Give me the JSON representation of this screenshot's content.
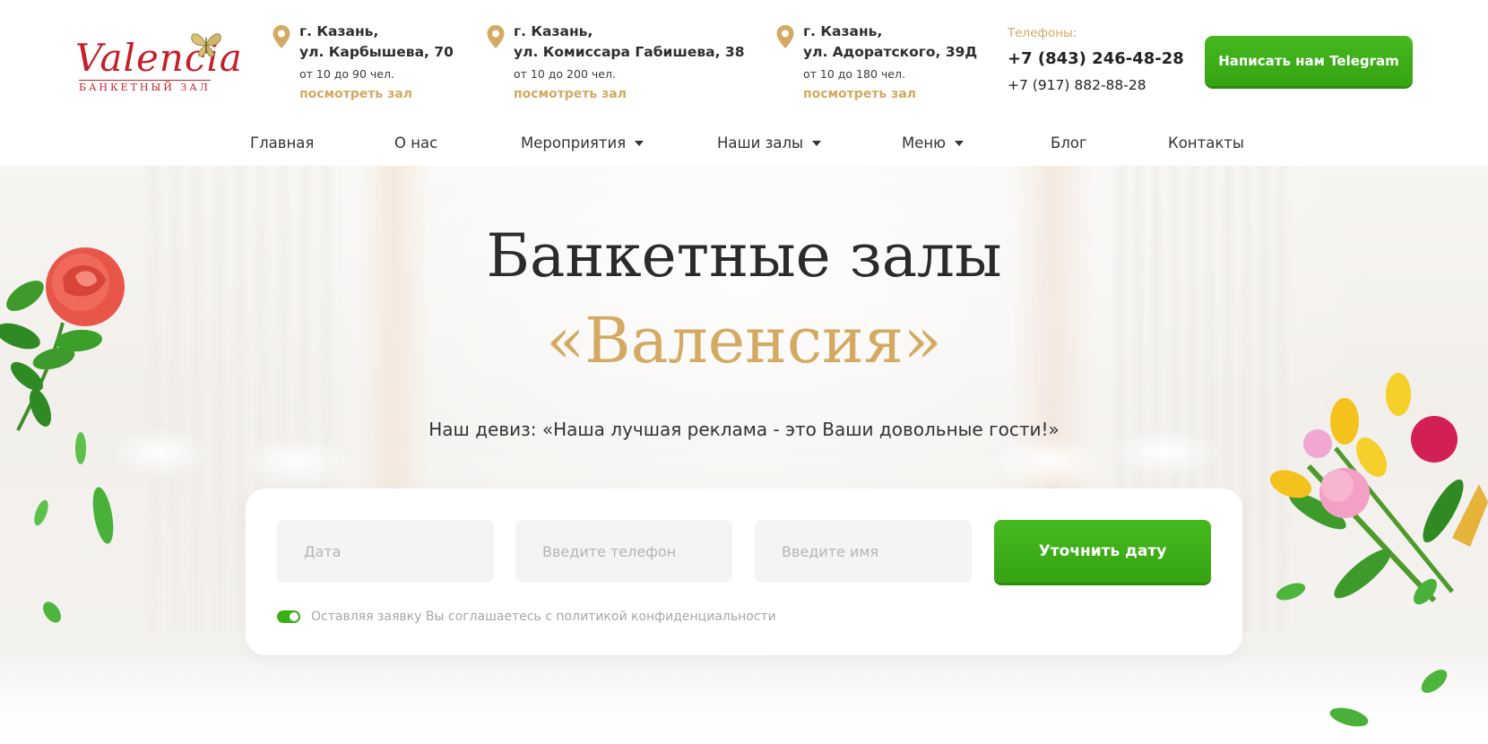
{
  "logo": {
    "name": "Valencia",
    "subtitle": "БАНКЕТНЫЙ ЗАЛ"
  },
  "addresses": [
    {
      "city": "г. Казань,",
      "street": "ул. Карбышева, 70",
      "capacity": "от 10 до 90 чел.",
      "link": "посмотреть зал"
    },
    {
      "city": "г. Казань,",
      "street": "ул. Комиссара Габишева, 38",
      "capacity": "от 10 до 200 чел.",
      "link": "посмотреть зал"
    },
    {
      "city": "г. Казань,",
      "street": "ул. Адоратского, 39Д",
      "capacity": "от 10 до 180 чел.",
      "link": "посмотреть зал"
    }
  ],
  "phones": {
    "label": "Телефоны:",
    "primary": "+7 (843) 246-48-28",
    "secondary": "+7 (917) 882-88-28"
  },
  "telegram_button": "Написать нам Telegram",
  "nav": [
    {
      "label": "Главная",
      "has_dropdown": false
    },
    {
      "label": "О нас",
      "has_dropdown": false
    },
    {
      "label": "Мероприятия",
      "has_dropdown": true
    },
    {
      "label": "Наши залы",
      "has_dropdown": true
    },
    {
      "label": "Меню",
      "has_dropdown": true
    },
    {
      "label": "Блог",
      "has_dropdown": false
    },
    {
      "label": "Контакты",
      "has_dropdown": false
    }
  ],
  "hero": {
    "title_line1": "Банкетные залы",
    "title_line2": "«Валенсия»",
    "motto": "Наш девиз: «Наша лучшая реклама - это Ваши довольные гости!»"
  },
  "form": {
    "date_placeholder": "Дата",
    "phone_placeholder": "Введите телефон",
    "name_placeholder": "Введите имя",
    "date_value": "",
    "phone_value": "",
    "name_value": "",
    "submit_label": "Уточнить дату",
    "consent_text": "Оставляя заявку Вы соглашаетесь с политикой конфиденциальности",
    "consent_checked": true
  },
  "colors": {
    "accent_gold": "#d4aa62",
    "button_green": "#3aae15",
    "logo_red": "#c4202a",
    "text_dark": "#2b2b2b"
  },
  "icons": {
    "address": "map-pin-icon",
    "nav_dropdown": "caret-down-icon",
    "logo_decoration": "butterfly-icon"
  }
}
